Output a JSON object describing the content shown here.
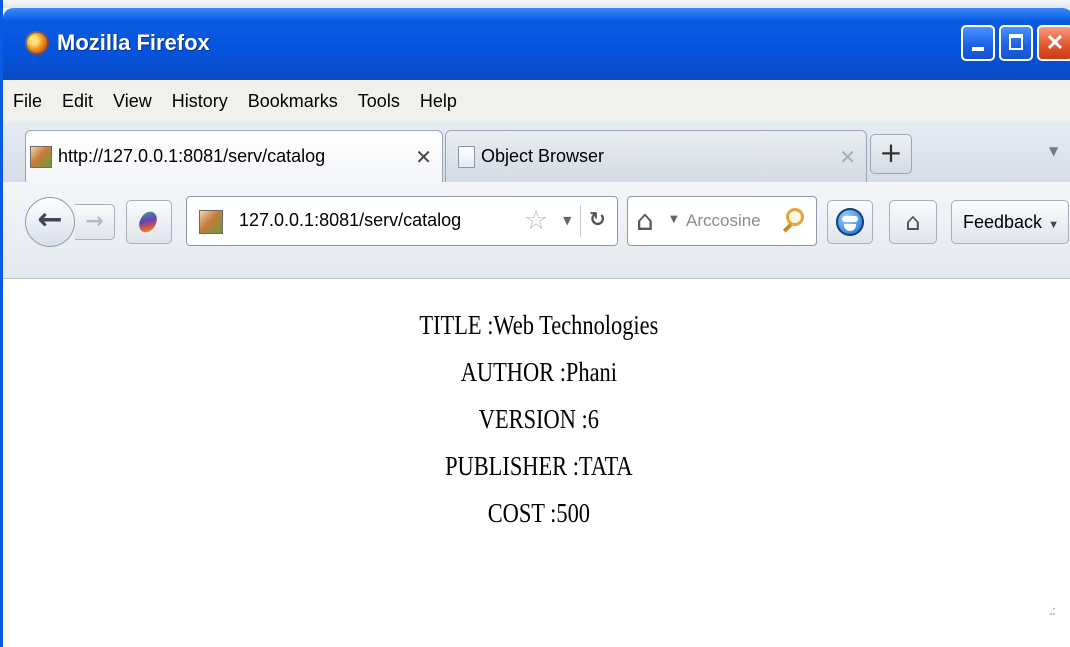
{
  "window": {
    "title": "Mozilla Firefox"
  },
  "menu": {
    "items": [
      "File",
      "Edit",
      "View",
      "History",
      "Bookmarks",
      "Tools",
      "Help"
    ]
  },
  "tabs": [
    {
      "label": "http://127.0.0.1:8081/serv/catalog",
      "active": true
    },
    {
      "label": "Object Browser",
      "active": false
    }
  ],
  "toolbar": {
    "url": "127.0.0.1:8081/serv/catalog",
    "search_placeholder": "Arccosine",
    "feedback_label": "Feedback"
  },
  "page": {
    "title": "TITLE :Web Technologies",
    "author": "AUTHOR :Phani",
    "version": "VERSION :6",
    "publisher": "PUBLISHER :TATA",
    "cost": "COST :500"
  }
}
